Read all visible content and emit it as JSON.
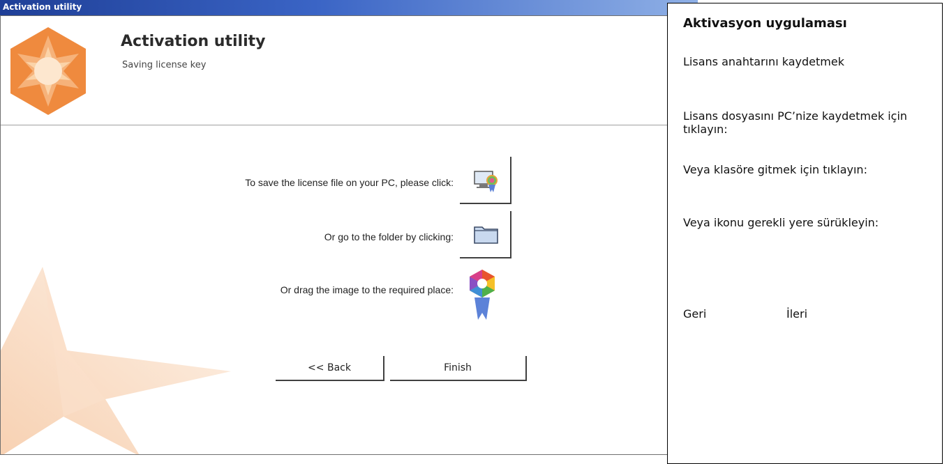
{
  "window": {
    "title": "Activation utility"
  },
  "header": {
    "title": "Activation utility",
    "subtitle": "Saving license key"
  },
  "rows": [
    {
      "label": "To save the license file on your PC, please click:",
      "icon": "save-license-to-pc-icon"
    },
    {
      "label": "Or go to the folder by clicking:",
      "icon": "folder-icon"
    },
    {
      "label": "Or drag the image to the required place:",
      "icon": "license-badge-icon"
    }
  ],
  "buttons": {
    "back": "<< Back",
    "finish": "Finish"
  },
  "translation_panel": {
    "title": "Aktivasyon uygulaması",
    "subtitle": "Lisans anahtarını kaydetmek",
    "row1": "Lisans dosyasını PC’nize kaydetmek için tıklayın:",
    "row2": "Veya klasöre gitmek için tıklayın:",
    "row3": "Veya ikonu gerekli yere sürükleyin:",
    "back": "Geri",
    "next": "İleri"
  },
  "colors": {
    "titlebar_dark": "#1f3f97",
    "titlebar_light": "#8fb0e6",
    "logo_orange": "#ef8a3e",
    "logo_light": "#fde7cf"
  }
}
